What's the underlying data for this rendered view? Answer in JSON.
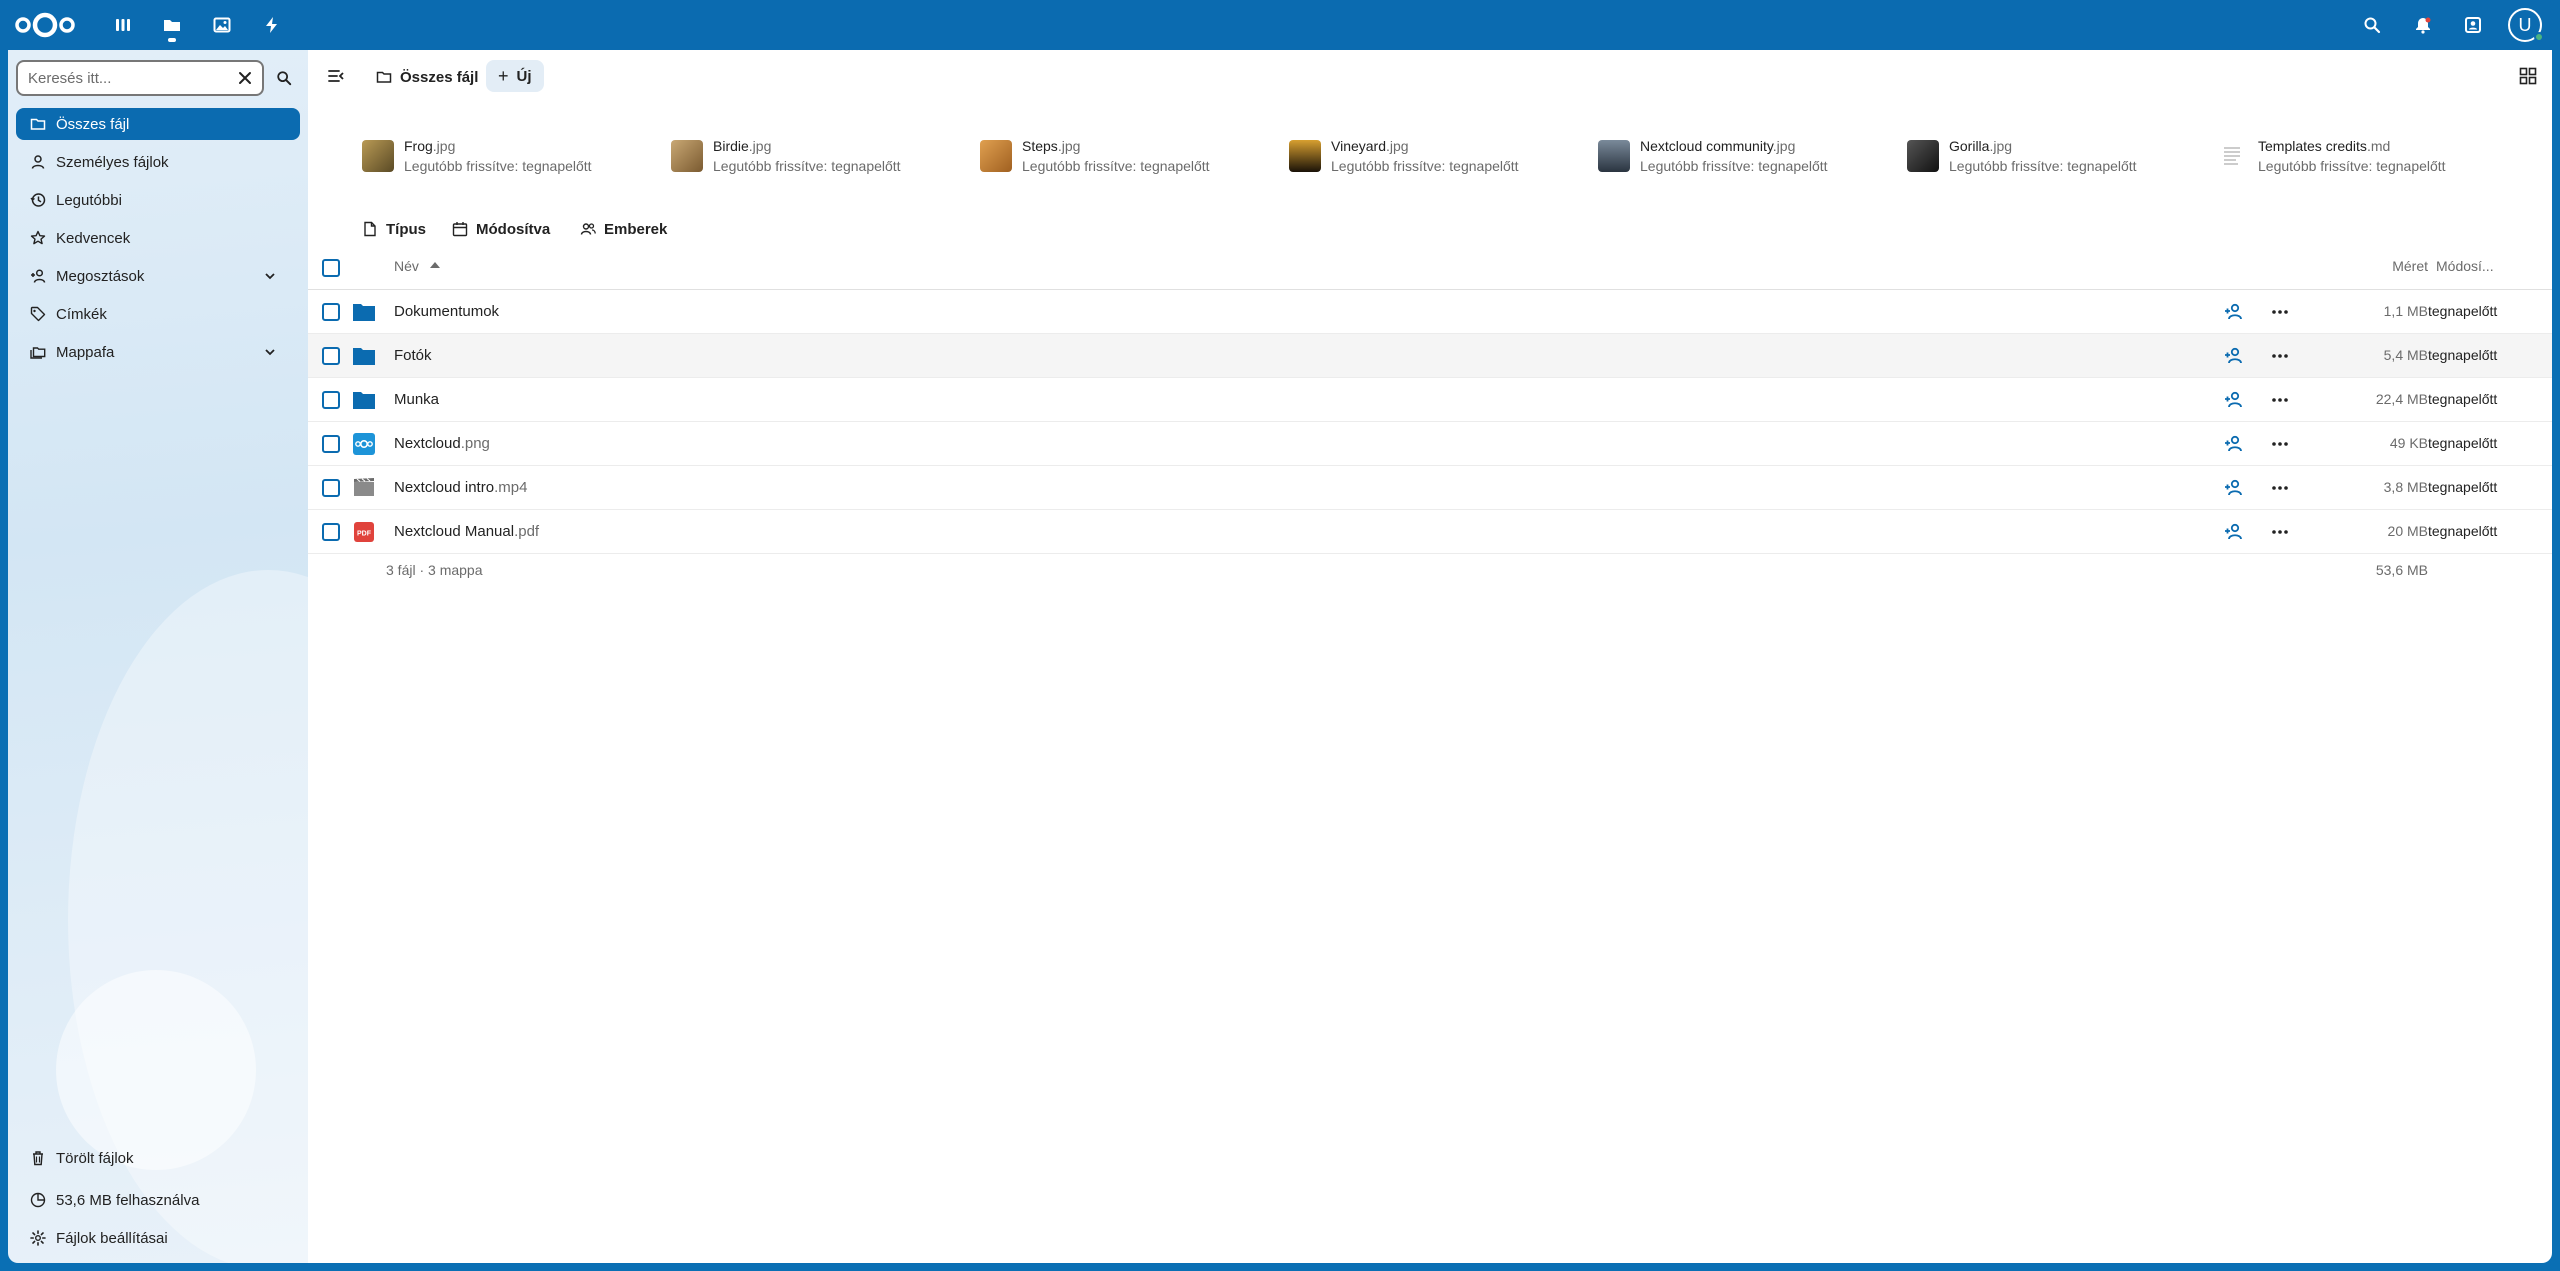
{
  "header": {
    "apps": [
      "dashboard-icon",
      "files-icon",
      "photos-icon",
      "activity-icon"
    ],
    "right_icons": [
      "search-icon",
      "notifications-icon",
      "contacts-icon"
    ],
    "avatar_letter": "U"
  },
  "sidebar": {
    "search_placeholder": "Keresés itt...",
    "items": [
      {
        "label": "Összes fájl",
        "icon": "folder-icon",
        "active": true
      },
      {
        "label": "Személyes fájlok",
        "icon": "person-icon"
      },
      {
        "label": "Legutóbbi",
        "icon": "history-icon"
      },
      {
        "label": "Kedvencek",
        "icon": "star-icon"
      },
      {
        "label": "Megosztások",
        "icon": "share-icon",
        "expandable": true
      },
      {
        "label": "Címkék",
        "icon": "tag-icon"
      },
      {
        "label": "Mappafa",
        "icon": "folder-tree-icon",
        "expandable": true
      }
    ],
    "bottom": {
      "deleted": "Törölt fájlok",
      "quota": "53,6 MB felhasználva",
      "settings": "Fájlok beállításai"
    }
  },
  "main": {
    "breadcrumb": "Összes fájl",
    "new_button": "Új",
    "recent": [
      {
        "name": "Frog",
        "ext": ".jpg",
        "sub": "Legutóbb frissítve: tegnapelőtt",
        "color": "#7a6a3a"
      },
      {
        "name": "Birdie",
        "ext": ".jpg",
        "sub": "Legutóbb frissítve: tegnapelőtt",
        "color": "#9a7a4a"
      },
      {
        "name": "Steps",
        "ext": ".jpg",
        "sub": "Legutóbb frissítve: tegnapelőtt",
        "color": "#c98a3a"
      },
      {
        "name": "Vineyard",
        "ext": ".jpg",
        "sub": "Legutóbb frissítve: tegnapelőtt",
        "color": "#3a2a10"
      },
      {
        "name": "Nextcloud community",
        "ext": ".jpg",
        "sub": "Legutóbb frissítve: tegnapelőtt",
        "color": "#4a5a6a"
      },
      {
        "name": "Gorilla",
        "ext": ".jpg",
        "sub": "Legutóbb frissítve: tegnapelőtt",
        "color": "#2a2a2a"
      },
      {
        "name": "Templates credits",
        "ext": ".md",
        "sub": "Legutóbb frissítve: tegnapelőtt",
        "color": "#ffffff"
      }
    ],
    "filters": {
      "type": "Típus",
      "modified": "Módosítva",
      "people": "Emberek"
    },
    "columns": {
      "name": "Név",
      "size": "Méret",
      "modified": "Módosí..."
    },
    "files": [
      {
        "name": "Dokumentumok",
        "ext": "",
        "kind": "folder",
        "size": "1,1 MB",
        "modified": "tegnapelőtt"
      },
      {
        "name": "Fotók",
        "ext": "",
        "kind": "folder",
        "size": "5,4 MB",
        "modified": "tegnapelőtt"
      },
      {
        "name": "Munka",
        "ext": "",
        "kind": "folder",
        "size": "22,4 MB",
        "modified": "tegnapelőtt"
      },
      {
        "name": "Nextcloud",
        "ext": ".png",
        "kind": "image",
        "size": "49 KB",
        "modified": "tegnapelőtt"
      },
      {
        "name": "Nextcloud intro",
        "ext": ".mp4",
        "kind": "video",
        "size": "3,8 MB",
        "modified": "tegnapelőtt"
      },
      {
        "name": "Nextcloud Manual",
        "ext": ".pdf",
        "kind": "pdf",
        "size": "20 MB",
        "modified": "tegnapelőtt"
      }
    ],
    "summary": "3 fájl · 3 mappa",
    "summary_size": "53,6 MB"
  },
  "colors": {
    "primary": "#0b6bb0",
    "folder": "#0b6bb0",
    "pdf": "#e0433c"
  }
}
